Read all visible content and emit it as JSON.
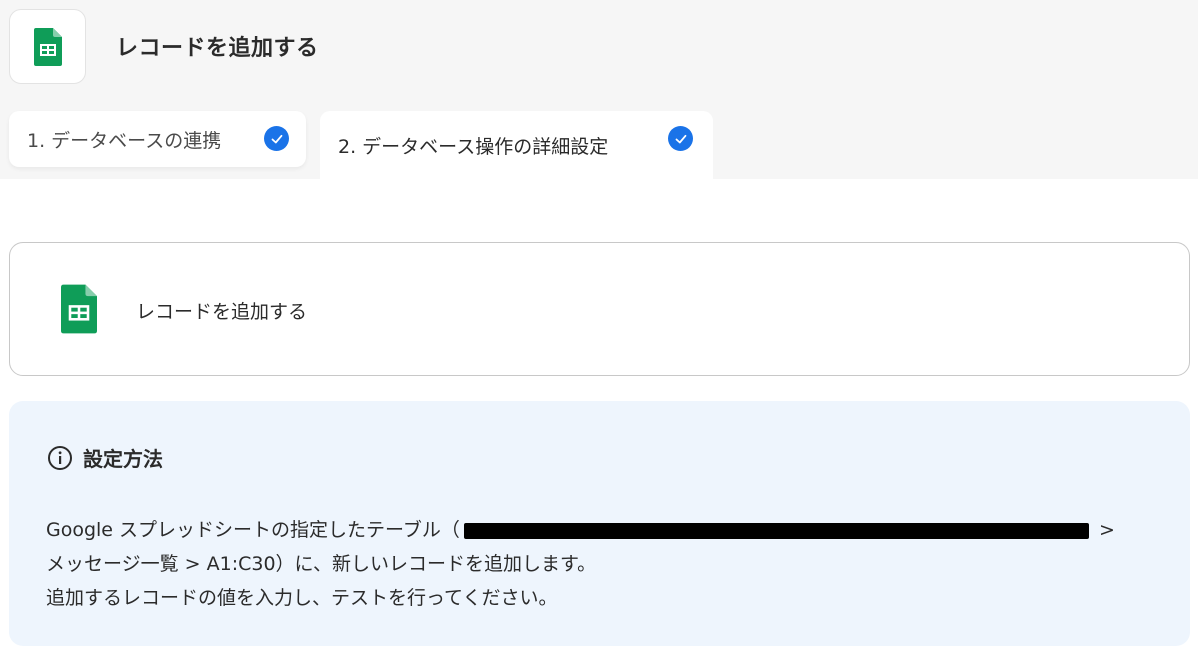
{
  "header": {
    "title": "レコードを追加する",
    "app_icon": "google-sheets-icon"
  },
  "tabs": [
    {
      "label": "1. データベースの連携",
      "completed": true
    },
    {
      "label": "2. データベース操作の詳細設定",
      "completed": true
    }
  ],
  "action_card": {
    "label": "レコードを追加する",
    "icon": "google-sheets-icon"
  },
  "info": {
    "icon": "info-icon",
    "title": "設定方法",
    "line1_before": "Google スプレッドシートの指定したテーブル（",
    "line1_after": " >",
    "line2": "メッセージ一覧 > A1:C30）に、新しいレコードを追加します。",
    "line3": "追加するレコードの値を入力し、テストを行ってください。"
  },
  "colors": {
    "accent": "#1a73e8",
    "sheets_green": "#0f9d58",
    "info_bg": "#eef5fd"
  }
}
